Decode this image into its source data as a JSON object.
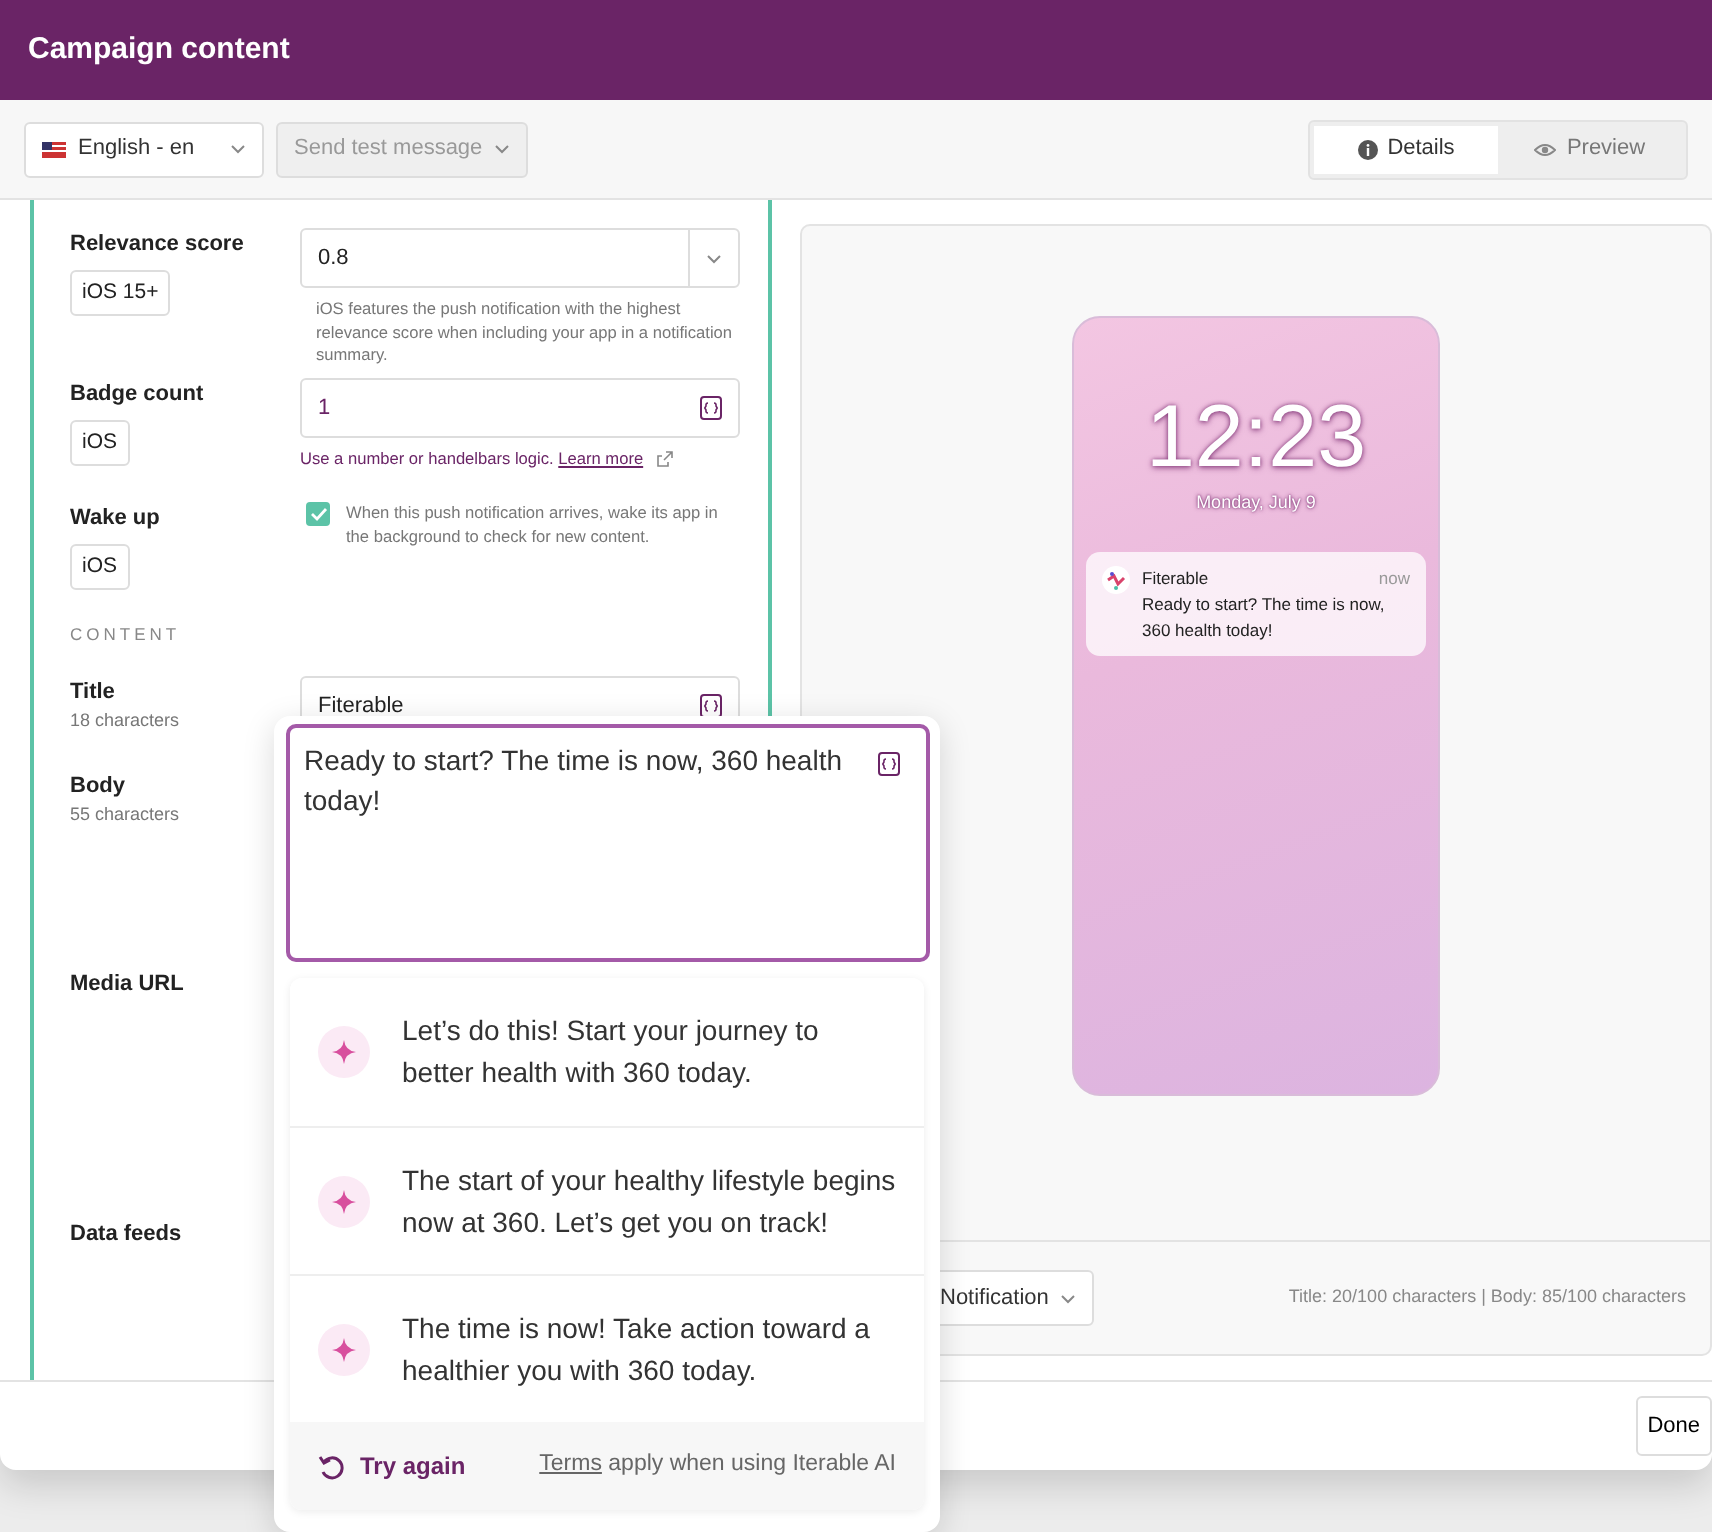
{
  "window": {
    "title": "Campaign content"
  },
  "toolbar": {
    "language": "English - en",
    "send_test": {
      "label": "Send test message",
      "disabled": true
    },
    "view_tabs": [
      {
        "label": "Details",
        "selected": true,
        "kind": "info"
      },
      {
        "label": "Preview",
        "selected": false,
        "kind": "eye"
      }
    ]
  },
  "form": {
    "fields": [
      {
        "kind": "select",
        "label": "Relevance score",
        "platform": "iOS 15+",
        "value": "0.8",
        "help": "iOS features the push notification with the highest relevance score when including your app in a notification summary."
      },
      {
        "kind": "text",
        "label": "Badge count",
        "platform": "iOS",
        "value": "1",
        "help": "Use a number or handelbars logic.",
        "link": "Learn more"
      },
      {
        "kind": "checkbox",
        "label": "Wake up",
        "platform": "iOS",
        "checked": true,
        "help": "When this push notification arrives, wake its app in the background to check for new content."
      },
      {
        "kind": "section",
        "label": "CONTENT"
      },
      {
        "kind": "text",
        "label": "Title",
        "count": "18 characters",
        "value": "Fiterable"
      },
      {
        "kind": "covered",
        "label": "Body",
        "count": "55 characters"
      },
      {
        "kind": "covered",
        "label": "Media URL"
      },
      {
        "kind": "covered",
        "label": "Data feeds"
      }
    ]
  },
  "preview": {
    "time": "12:23",
    "date": "Monday, July 9",
    "notification": {
      "app": "Fiterable",
      "time": "now",
      "text": "Ready to start? The time is now, 360 health today!"
    },
    "format": "Notification",
    "counts": "Title: 20/100 characters | Body: 85/100 characters"
  },
  "footer": {
    "done": "Done"
  },
  "ai_popover": {
    "body": "Ready to start? The time is now, 360 health today!",
    "suggestions": [
      "Let’s do this! Start your journey to better health with 360 today.",
      "The start of your healthy lifestyle begins now at 360. Let’s get you on track!",
      "The time is now! Take action toward a healthier you with 360 today."
    ],
    "retry": "Try again",
    "terms_link": "Terms",
    "terms_text": "apply when using Iterable AI"
  }
}
